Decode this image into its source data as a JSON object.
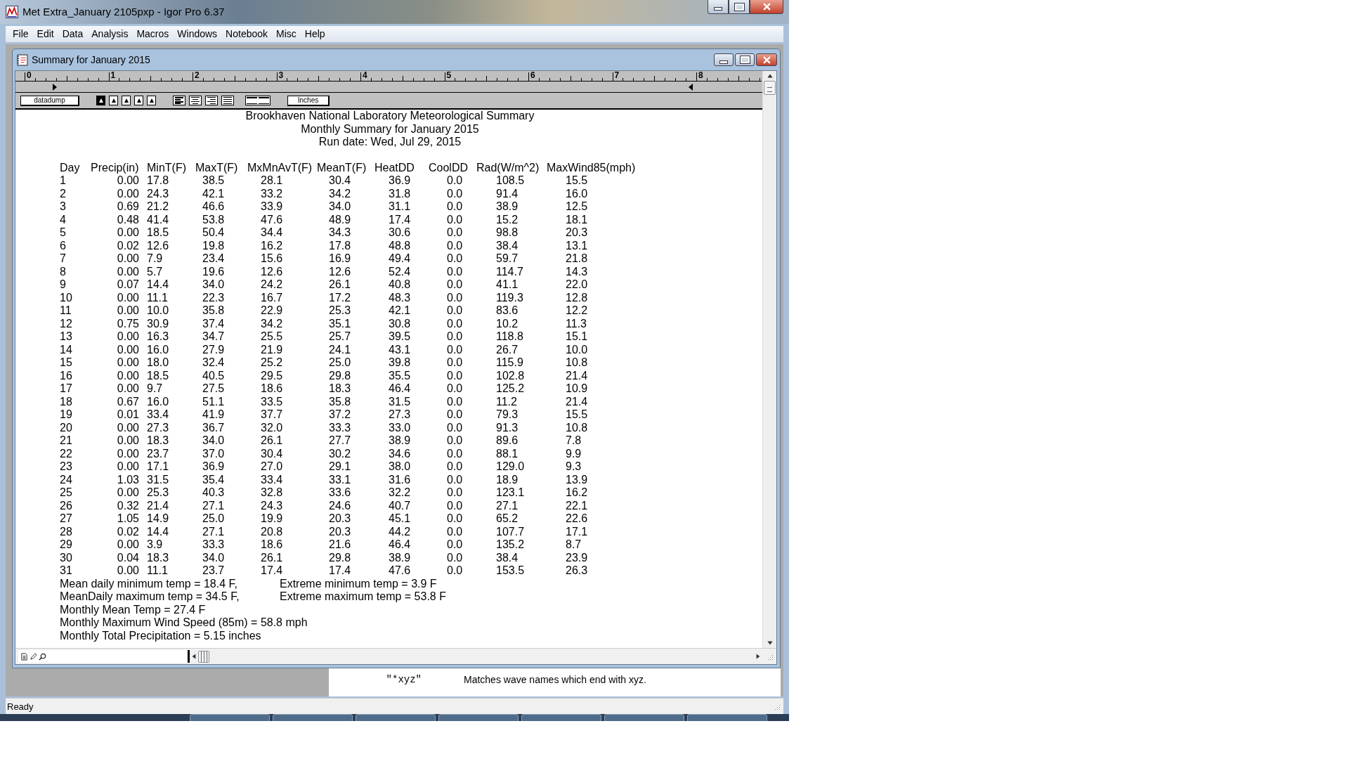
{
  "window": {
    "title": "Met Extra_January 2105pxp - Igor Pro 6.37"
  },
  "menu": [
    {
      "label": "File"
    },
    {
      "label": "Edit"
    },
    {
      "label": "Data"
    },
    {
      "label": "Analysis"
    },
    {
      "label": "Macros"
    },
    {
      "label": "Windows"
    },
    {
      "label": "Notebook"
    },
    {
      "label": "Misc"
    },
    {
      "label": "Help"
    }
  ],
  "notebook": {
    "title": "Summary for January 2015",
    "ruler": [
      "0",
      "1",
      "2",
      "3",
      "4",
      "5",
      "6",
      "7",
      "8"
    ],
    "toolbar": {
      "ruler_name": "datadump",
      "spacing_buttons": [
        {
          "selected": true
        },
        {
          "selected": false
        },
        {
          "selected": false
        },
        {
          "selected": false
        },
        {
          "selected": false
        }
      ],
      "align_buttons": [
        {
          "selected": true
        },
        {
          "selected": false
        },
        {
          "selected": false
        },
        {
          "selected": false
        }
      ],
      "units": "Inches"
    },
    "heading": [
      "Brookhaven National Laboratory Meteorological Summary",
      "Monthly Summary for January 2015",
      "Run date: Wed, Jul 29, 2015"
    ],
    "columns": [
      "Day",
      "Precip(in)",
      "MinT(F)",
      "MaxT(F)",
      "MxMnAvT(F)",
      "MeanT(F)",
      "HeatDD",
      "CoolDD",
      "Rad(W/m^2)",
      "MaxWind85(mph)"
    ],
    "rows": [
      [
        "1",
        "0.00",
        "17.8",
        "38.5",
        "28.1",
        "30.4",
        "36.9",
        "0.0",
        "108.5",
        "15.5"
      ],
      [
        "2",
        "0.00",
        "24.3",
        "42.1",
        "33.2",
        "34.2",
        "31.8",
        "0.0",
        "91.4",
        "16.0"
      ],
      [
        "3",
        "0.69",
        "21.2",
        "46.6",
        "33.9",
        "34.0",
        "31.1",
        "0.0",
        "38.9",
        "12.5"
      ],
      [
        "4",
        "0.48",
        "41.4",
        "53.8",
        "47.6",
        "48.9",
        "17.4",
        "0.0",
        "15.2",
        "18.1"
      ],
      [
        "5",
        "0.00",
        "18.5",
        "50.4",
        "34.4",
        "34.3",
        "30.6",
        "0.0",
        "98.8",
        "20.3"
      ],
      [
        "6",
        "0.02",
        "12.6",
        "19.8",
        "16.2",
        "17.8",
        "48.8",
        "0.0",
        "38.4",
        "13.1"
      ],
      [
        "7",
        "0.00",
        "7.9",
        "23.4",
        "15.6",
        "16.9",
        "49.4",
        "0.0",
        "59.7",
        "21.8"
      ],
      [
        "8",
        "0.00",
        "5.7",
        "19.6",
        "12.6",
        "12.6",
        "52.4",
        "0.0",
        "114.7",
        "14.3"
      ],
      [
        "9",
        "0.07",
        "14.4",
        "34.0",
        "24.2",
        "26.1",
        "40.8",
        "0.0",
        "41.1",
        "22.0"
      ],
      [
        "10",
        "0.00",
        "11.1",
        "22.3",
        "16.7",
        "17.2",
        "48.3",
        "0.0",
        "119.3",
        "12.8"
      ],
      [
        "11",
        "0.00",
        "10.0",
        "35.8",
        "22.9",
        "25.3",
        "42.1",
        "0.0",
        "83.6",
        "12.2"
      ],
      [
        "12",
        "0.75",
        "30.9",
        "37.4",
        "34.2",
        "35.1",
        "30.8",
        "0.0",
        "10.2",
        "11.3"
      ],
      [
        "13",
        "0.00",
        "16.3",
        "34.7",
        "25.5",
        "25.7",
        "39.5",
        "0.0",
        "118.8",
        "15.1"
      ],
      [
        "14",
        "0.00",
        "16.0",
        "27.9",
        "21.9",
        "24.1",
        "43.1",
        "0.0",
        "26.7",
        "10.0"
      ],
      [
        "15",
        "0.00",
        "18.0",
        "32.4",
        "25.2",
        "25.0",
        "39.8",
        "0.0",
        "115.9",
        "10.8"
      ],
      [
        "16",
        "0.00",
        "18.5",
        "40.5",
        "29.5",
        "29.8",
        "35.5",
        "0.0",
        "102.8",
        "21.4"
      ],
      [
        "17",
        "0.00",
        "9.7",
        "27.5",
        "18.6",
        "18.3",
        "46.4",
        "0.0",
        "125.2",
        "10.9"
      ],
      [
        "18",
        "0.67",
        "16.0",
        "51.1",
        "33.5",
        "35.8",
        "31.5",
        "0.0",
        "11.2",
        "21.4"
      ],
      [
        "19",
        "0.01",
        "33.4",
        "41.9",
        "37.7",
        "37.2",
        "27.3",
        "0.0",
        "79.3",
        "15.5"
      ],
      [
        "20",
        "0.00",
        "27.3",
        "36.7",
        "32.0",
        "33.3",
        "33.0",
        "0.0",
        "91.3",
        "10.8"
      ],
      [
        "21",
        "0.00",
        "18.3",
        "34.0",
        "26.1",
        "27.7",
        "38.9",
        "0.0",
        "89.6",
        "7.8"
      ],
      [
        "22",
        "0.00",
        "23.7",
        "37.0",
        "30.4",
        "30.2",
        "34.6",
        "0.0",
        "88.1",
        "9.9"
      ],
      [
        "23",
        "0.00",
        "17.1",
        "36.9",
        "27.0",
        "29.1",
        "38.0",
        "0.0",
        "129.0",
        "9.3"
      ],
      [
        "24",
        "1.03",
        "31.5",
        "35.4",
        "33.4",
        "33.1",
        "31.6",
        "0.0",
        "18.9",
        "13.9"
      ],
      [
        "25",
        "0.00",
        "25.3",
        "40.3",
        "32.8",
        "33.6",
        "32.2",
        "0.0",
        "123.1",
        "16.2"
      ],
      [
        "26",
        "0.32",
        "21.4",
        "27.1",
        "24.3",
        "24.6",
        "40.7",
        "0.0",
        "27.1",
        "22.1"
      ],
      [
        "27",
        "1.05",
        "14.9",
        "25.0",
        "19.9",
        "20.3",
        "45.1",
        "0.0",
        "65.2",
        "22.6"
      ],
      [
        "28",
        "0.02",
        "14.4",
        "27.1",
        "20.8",
        "20.3",
        "44.2",
        "0.0",
        "107.7",
        "17.1"
      ],
      [
        "29",
        "0.00",
        "3.9",
        "33.3",
        "18.6",
        "21.6",
        "46.4",
        "0.0",
        "135.2",
        "8.7"
      ],
      [
        "30",
        "0.04",
        "18.3",
        "34.0",
        "26.1",
        "29.8",
        "38.9",
        "0.0",
        "38.4",
        "23.9"
      ],
      [
        "31",
        "0.00",
        "11.1",
        "23.7",
        "17.4",
        "17.4",
        "47.6",
        "0.0",
        "153.5",
        "26.3"
      ]
    ],
    "summary": [
      [
        "Mean daily minimum temp = 18.4 F,",
        "Extreme minimum temp = 3.9 F"
      ],
      [
        "MeanDaily maximum temp = 34.5 F,",
        "Extreme maximum temp = 53.8 F"
      ],
      [
        "Monthly Mean Temp = 27.4 F"
      ],
      [
        "Monthly Maximum Wind Speed (85m) = 58.8 mph"
      ],
      [
        "Monthly Total Precipitation = 5.15 inches"
      ]
    ]
  },
  "help_panel": [
    {
      "pattern": "\"*xyz\"",
      "description": "Matches wave names which end with xyz."
    }
  ],
  "status_bar": "Ready"
}
